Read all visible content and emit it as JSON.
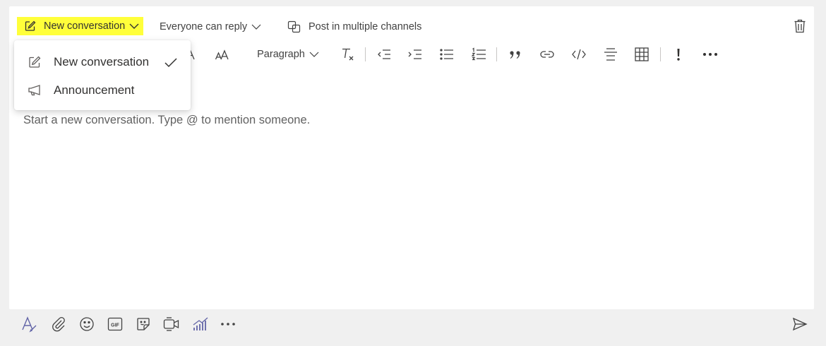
{
  "composer": {
    "type_selector": {
      "label": "New conversation",
      "highlight_color": "#ffff3a"
    },
    "reply_setting": {
      "label": "Everyone can reply"
    },
    "multi_channel": {
      "label": "Post in multiple channels"
    },
    "delete_icon": "trash-icon"
  },
  "toolbar": {
    "paragraph_label": "Paragraph",
    "icons": [
      "bold-a-icon",
      "font-size-icon",
      "clear-formatting-icon",
      "decrease-indent-icon",
      "increase-indent-icon",
      "bulleted-list-icon",
      "numbered-list-icon",
      "quote-icon",
      "link-icon",
      "code-snippet-icon",
      "horizontal-rule-icon",
      "table-icon",
      "mark-important-icon",
      "more-options-icon"
    ]
  },
  "menu": {
    "items": [
      {
        "label": "New conversation",
        "icon": "edit-icon",
        "selected": true
      },
      {
        "label": "Announcement",
        "icon": "megaphone-icon",
        "selected": false
      }
    ]
  },
  "editor": {
    "placeholder": "Start a new conversation. Type @ to mention someone."
  },
  "bottom": {
    "icons": [
      "format-icon",
      "attach-icon",
      "emoji-icon",
      "gif-icon",
      "sticker-icon",
      "meet-now-icon",
      "praise-icon",
      "more-icon"
    ],
    "send_icon": "send-icon",
    "accent": "#6264a7"
  }
}
